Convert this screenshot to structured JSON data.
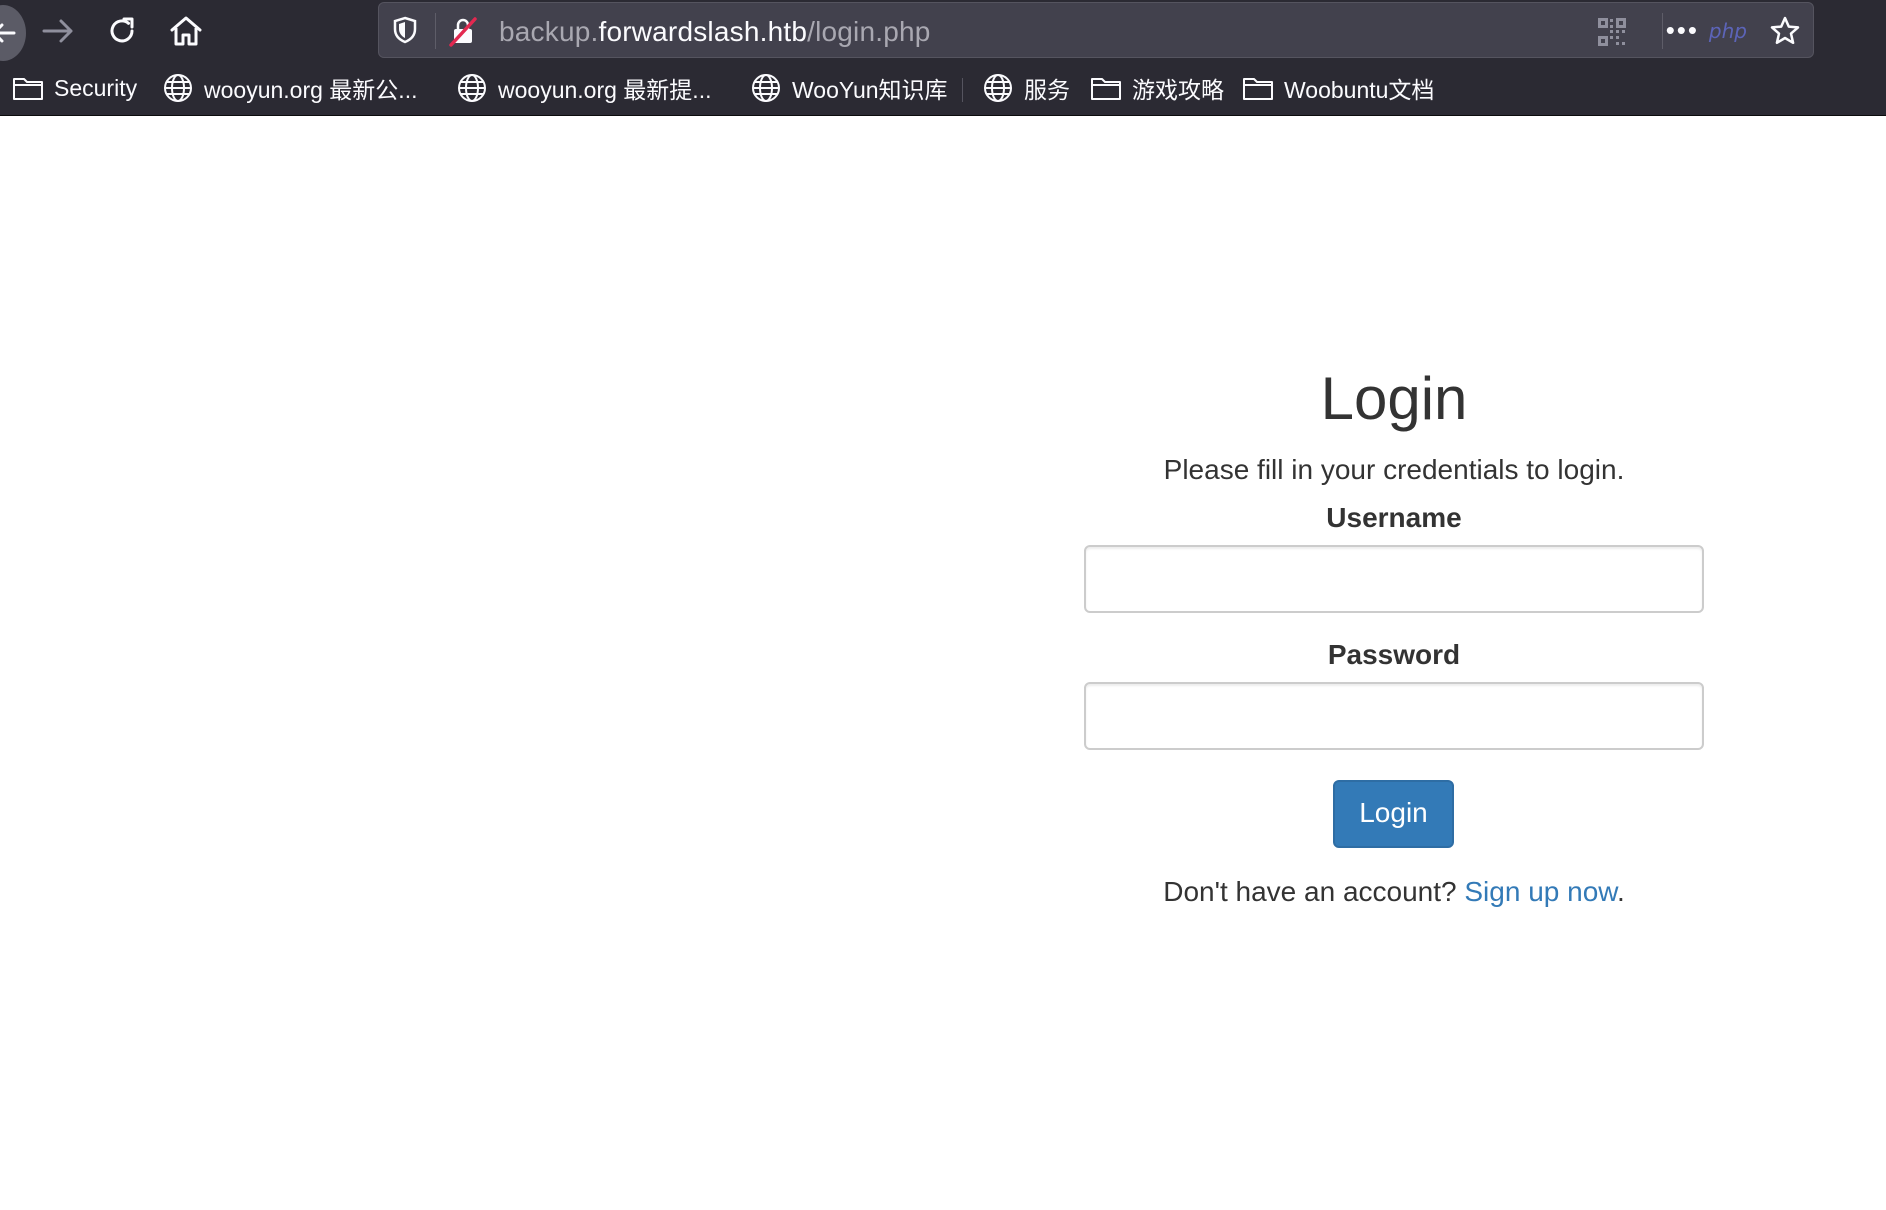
{
  "browser": {
    "url": {
      "prefix": "backup.",
      "host": "forwardslash.htb",
      "path": "/login.php"
    },
    "addon_label": "php"
  },
  "bookmarks": [
    {
      "label": "Security",
      "icon": "folder-icon"
    },
    {
      "label": "wooyun.org 最新公...",
      "icon": "globe-icon"
    },
    {
      "label": "wooyun.org 最新提...",
      "icon": "globe-icon"
    },
    {
      "label": "WooYun知识库",
      "icon": "globe-icon"
    },
    {
      "label": "服务",
      "icon": "globe-icon"
    },
    {
      "label": "游戏攻略",
      "icon": "folder-icon"
    },
    {
      "label": "Woobuntu文档",
      "icon": "folder-icon"
    }
  ],
  "page": {
    "title": "Login",
    "subtitle": "Please fill in your credentials to login.",
    "username_label": "Username",
    "username_value": "",
    "password_label": "Password",
    "password_value": "",
    "login_button": "Login",
    "signup_prompt": "Don't have an account? ",
    "signup_link": "Sign up now",
    "signup_suffix": "."
  },
  "colors": {
    "chrome_bg": "#2b2a33",
    "urlbar_bg": "#42414d",
    "button_primary": "#337ab7",
    "link": "#337ab7",
    "text": "#333333"
  }
}
